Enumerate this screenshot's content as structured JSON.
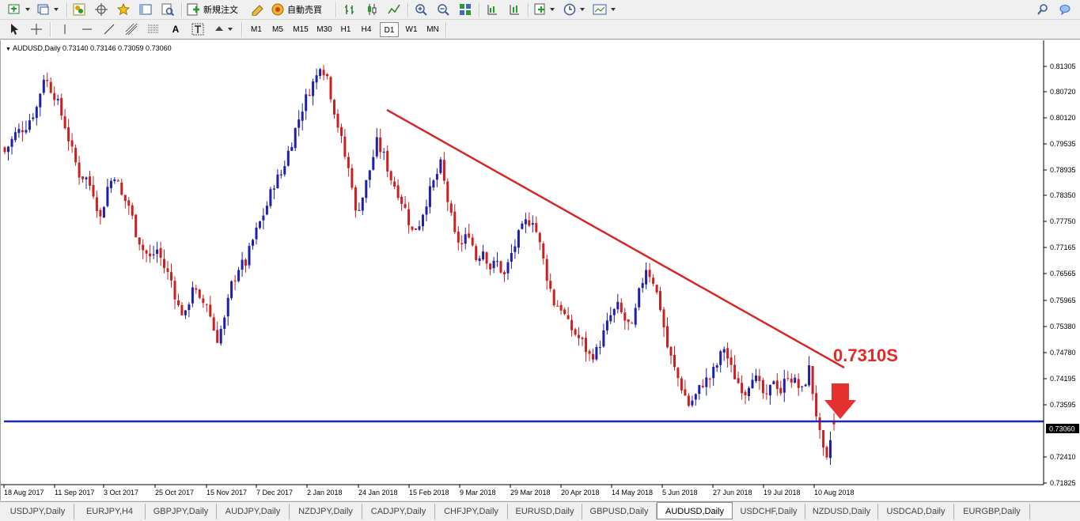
{
  "toolbar1": {
    "new_order_label": "新規注文",
    "auto_trade_label": "自動売買"
  },
  "toolbar2": {
    "timeframes": [
      "M1",
      "M5",
      "M15",
      "M30",
      "H1",
      "H4",
      "D1",
      "W1",
      "MN"
    ],
    "active_timeframe": "D1"
  },
  "chart": {
    "header": "AUDUSD,Daily  0.73140 0.73146 0.73059 0.73060",
    "current_price_label": "0.73060",
    "annotation": "0.7310S",
    "colors": {
      "bull": "#1f1fa8",
      "bear": "#cc2020",
      "trendline": "#d62828",
      "support": "#1c2aa8",
      "annotation": "#e52727",
      "arrow": "#e53030"
    }
  },
  "tabs": [
    "USDJPY,Daily",
    "EURJPY,H4",
    "GBPJPY,Daily",
    "AUDJPY,Daily",
    "NZDJPY,Daily",
    "CADJPY,Daily",
    "CHFJPY,Daily",
    "EURUSD,Daily",
    "GBPUSD,Daily",
    "AUDUSD,Daily",
    "USDCHF,Daily",
    "NZDUSD,Daily",
    "USDCAD,Daily",
    "EURGBP,Daily"
  ],
  "active_tab": "AUDUSD,Daily",
  "chart_data": {
    "type": "candlestick",
    "symbol": "AUDUSD",
    "timeframe": "Daily",
    "ohlc_last": {
      "open": 0.7314,
      "high": 0.73146,
      "low": 0.73059,
      "close": 0.7306
    },
    "y_ticks": [
      0.81305,
      0.8072,
      0.8012,
      0.79535,
      0.78935,
      0.7835,
      0.7775,
      0.77165,
      0.76565,
      0.75965,
      0.7538,
      0.7478,
      0.74195,
      0.73595,
      0.7306,
      0.7241,
      0.71825
    ],
    "x_ticks": [
      "18 Aug 2017",
      "11 Sep 2017",
      "3 Oct 2017",
      "25 Oct 2017",
      "15 Nov 2017",
      "7 Dec 2017",
      "2 Jan 2018",
      "24 Jan 2018",
      "15 Feb 2018",
      "9 Mar 2018",
      "29 Mar 2018",
      "20 Apr 2018",
      "14 May 2018",
      "5 Jun 2018",
      "27 Jun 2018",
      "19 Jul 2018",
      "10 Aug 2018"
    ],
    "ylim": [
      0.717,
      0.815
    ],
    "close_path": [
      [
        0,
        0.792
      ],
      [
        3,
        0.796
      ],
      [
        6,
        0.798
      ],
      [
        9,
        0.802
      ],
      [
        11,
        0.809
      ],
      [
        14,
        0.805
      ],
      [
        17,
        0.798
      ],
      [
        19,
        0.792
      ],
      [
        21,
        0.787
      ],
      [
        23,
        0.786
      ],
      [
        25,
        0.783
      ],
      [
        27,
        0.777
      ],
      [
        29,
        0.784
      ],
      [
        31,
        0.787
      ],
      [
        33,
        0.782
      ],
      [
        35,
        0.78
      ],
      [
        37,
        0.774
      ],
      [
        39,
        0.77
      ],
      [
        41,
        0.768
      ],
      [
        43,
        0.77
      ],
      [
        45,
        0.766
      ],
      [
        47,
        0.763
      ],
      [
        49,
        0.757
      ],
      [
        51,
        0.755
      ],
      [
        53,
        0.762
      ],
      [
        55,
        0.758
      ],
      [
        57,
        0.758
      ],
      [
        59,
        0.752
      ],
      [
        60,
        0.75
      ],
      [
        62,
        0.754
      ],
      [
        64,
        0.762
      ],
      [
        66,
        0.766
      ],
      [
        68,
        0.767
      ],
      [
        70,
        0.772
      ],
      [
        72,
        0.776
      ],
      [
        74,
        0.78
      ],
      [
        76,
        0.785
      ],
      [
        78,
        0.787
      ],
      [
        80,
        0.792
      ],
      [
        82,
        0.797
      ],
      [
        84,
        0.802
      ],
      [
        86,
        0.806
      ],
      [
        88,
        0.809
      ],
      [
        89,
        0.812
      ],
      [
        91,
        0.809
      ],
      [
        92,
        0.805
      ],
      [
        94,
        0.798
      ],
      [
        96,
        0.791
      ],
      [
        98,
        0.785
      ],
      [
        99,
        0.778
      ],
      [
        101,
        0.782
      ],
      [
        103,
        0.788
      ],
      [
        105,
        0.794
      ],
      [
        107,
        0.791
      ],
      [
        109,
        0.786
      ],
      [
        111,
        0.783
      ],
      [
        113,
        0.779
      ],
      [
        115,
        0.774
      ],
      [
        117,
        0.776
      ],
      [
        119,
        0.781
      ],
      [
        121,
        0.785
      ],
      [
        123,
        0.789
      ],
      [
        125,
        0.781
      ],
      [
        127,
        0.773
      ],
      [
        129,
        0.771
      ],
      [
        131,
        0.774
      ],
      [
        133,
        0.768
      ],
      [
        135,
        0.77
      ],
      [
        137,
        0.766
      ],
      [
        139,
        0.767
      ],
      [
        141,
        0.764
      ],
      [
        143,
        0.769
      ],
      [
        145,
        0.773
      ],
      [
        147,
        0.776
      ],
      [
        149,
        0.777
      ],
      [
        151,
        0.771
      ],
      [
        153,
        0.764
      ],
      [
        155,
        0.758
      ],
      [
        157,
        0.757
      ],
      [
        159,
        0.753
      ],
      [
        161,
        0.751
      ],
      [
        163,
        0.749
      ],
      [
        165,
        0.746
      ],
      [
        167,
        0.747
      ],
      [
        169,
        0.751
      ],
      [
        171,
        0.755
      ],
      [
        173,
        0.757
      ],
      [
        175,
        0.754
      ],
      [
        177,
        0.752
      ],
      [
        179,
        0.76
      ],
      [
        181,
        0.766
      ],
      [
        183,
        0.763
      ],
      [
        185,
        0.757
      ],
      [
        187,
        0.748
      ],
      [
        189,
        0.743
      ],
      [
        191,
        0.739
      ],
      [
        193,
        0.735
      ],
      [
        195,
        0.737
      ],
      [
        197,
        0.74
      ],
      [
        199,
        0.741
      ],
      [
        201,
        0.744
      ],
      [
        203,
        0.748
      ],
      [
        205,
        0.743
      ],
      [
        207,
        0.74
      ],
      [
        209,
        0.738
      ],
      [
        211,
        0.742
      ],
      [
        213,
        0.739
      ],
      [
        215,
        0.736
      ],
      [
        217,
        0.741
      ],
      [
        219,
        0.738
      ],
      [
        221,
        0.742
      ],
      [
        223,
        0.74
      ],
      [
        225,
        0.738
      ],
      [
        227,
        0.743
      ],
      [
        228,
        0.738
      ],
      [
        229,
        0.733
      ],
      [
        230,
        0.728
      ],
      [
        231,
        0.724
      ],
      [
        232,
        0.722
      ],
      [
        233,
        0.727
      ],
      [
        234,
        0.7306
      ]
    ]
  }
}
